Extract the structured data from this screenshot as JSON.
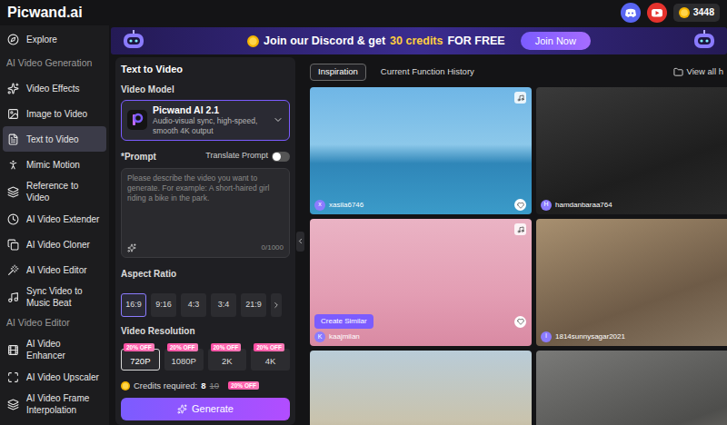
{
  "app": {
    "logo": "Picwand.ai",
    "credits": "3448"
  },
  "sidebar": {
    "items": [
      {
        "kind": "item",
        "label": "Explore",
        "selected": false
      },
      {
        "kind": "section",
        "label": "AI Video Generation",
        "selected": false
      },
      {
        "kind": "item",
        "label": "Video Effects",
        "selected": false
      },
      {
        "kind": "item",
        "label": "Image to Video",
        "selected": false
      },
      {
        "kind": "item",
        "label": "Text to Video",
        "selected": true
      },
      {
        "kind": "item",
        "label": "Mimic Motion",
        "selected": false
      },
      {
        "kind": "item",
        "label": "Reference to Video",
        "selected": false
      },
      {
        "kind": "item",
        "label": "AI Video Extender",
        "selected": false
      },
      {
        "kind": "item",
        "label": "AI Video Cloner",
        "selected": false
      },
      {
        "kind": "item",
        "label": "AI Video Editor",
        "selected": false
      },
      {
        "kind": "item",
        "label": "Sync Video to Music Beat",
        "selected": false
      },
      {
        "kind": "section",
        "label": "AI Video Editor",
        "selected": false
      },
      {
        "kind": "item",
        "label": "AI Video Enhancer",
        "selected": false
      },
      {
        "kind": "item",
        "label": "AI Video Upscaler",
        "selected": false
      },
      {
        "kind": "item",
        "label": "AI Video Frame Interpolation",
        "selected": false
      }
    ]
  },
  "banner": {
    "text_before": "Join our Discord & get",
    "highlight": "30 credits",
    "text_after": "FOR FREE",
    "button": "Join Now"
  },
  "panel": {
    "title": "Text to Video",
    "model_label": "Video Model",
    "model": {
      "name": "Picwand AI 2.1",
      "description": "Audio-visual sync, high-speed, smooth 4K output"
    },
    "prompt_label": "*Prompt",
    "translate": {
      "label": "Translate Prompt",
      "on": false
    },
    "prompt_placeholder": "Please describe the video you want to generate. For example: A short-haired girl riding a bike in the park.",
    "prompt_counter": "0/1000",
    "aspect_label": "Aspect Ratio",
    "aspect_ratios": [
      {
        "label": "16:9",
        "selected": true
      },
      {
        "label": "9:16",
        "selected": false
      },
      {
        "label": "4:3",
        "selected": false
      },
      {
        "label": "3:4",
        "selected": false
      },
      {
        "label": "21:9",
        "selected": false
      }
    ],
    "resolution_label": "Video Resolution",
    "resolutions": [
      {
        "label": "720P",
        "badge": "20% OFF",
        "selected": true
      },
      {
        "label": "1080P",
        "badge": "20% OFF",
        "selected": false
      },
      {
        "label": "2K",
        "badge": "20% OFF",
        "selected": false
      },
      {
        "label": "4K",
        "badge": "20% OFF",
        "selected": false
      }
    ],
    "credits": {
      "label": "Credits required:",
      "price": "8",
      "old_price": "10",
      "badge": "20% OFF"
    },
    "generate": "Generate"
  },
  "gallery": {
    "tabs": [
      {
        "label": "Inspiration",
        "selected": true
      },
      {
        "label": "Current Function History",
        "selected": false
      }
    ],
    "view_all": "View all h",
    "cards": [
      {
        "avatar": "x",
        "user": "xasila6746",
        "audio": true,
        "action": null
      },
      {
        "avatar": "H",
        "user": "hamdanbaraa764",
        "audio": true,
        "action": null
      },
      {
        "avatar": "K",
        "user": "kaajmilan",
        "audio": true,
        "action": "Create Similar"
      },
      {
        "avatar": "I",
        "user": "1814sunnysagar2021",
        "audio": false,
        "action": null
      },
      {
        "avatar": null,
        "user": null,
        "audio": false,
        "action": null
      },
      {
        "avatar": null,
        "user": null,
        "audio": false,
        "action": null
      }
    ]
  }
}
